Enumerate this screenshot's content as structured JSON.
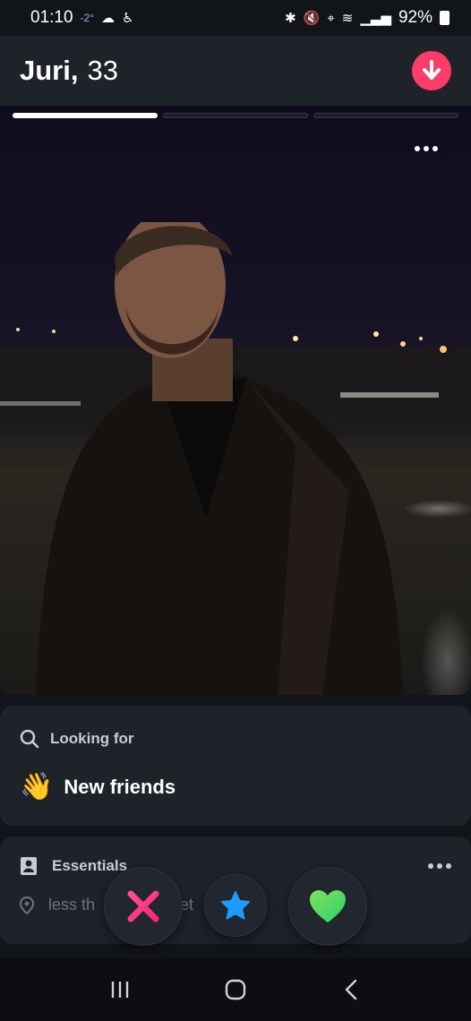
{
  "status_bar": {
    "time": "01:10",
    "temperature": "-2°",
    "battery": "92%"
  },
  "profile": {
    "name": "Juri,",
    "age": "33"
  },
  "photos": {
    "count": 3,
    "active_index": 0
  },
  "looking_for": {
    "label": "Looking for",
    "emoji": "👋",
    "value": "New friends"
  },
  "essentials": {
    "label": "Essentials",
    "distance": "less th                 net        y."
  },
  "icons": {
    "search": "search-icon",
    "down": "arrow-down-icon",
    "essentials": "id-card-icon",
    "location": "location-pin-icon",
    "nope": "x-icon",
    "super_like": "star-icon",
    "like": "heart-icon"
  },
  "colors": {
    "accent": "#fd3c68",
    "nope": "#fd267d",
    "star": "#1e9bff",
    "like": "#5cd85a",
    "card": "#1e2229",
    "background": "#111418"
  }
}
